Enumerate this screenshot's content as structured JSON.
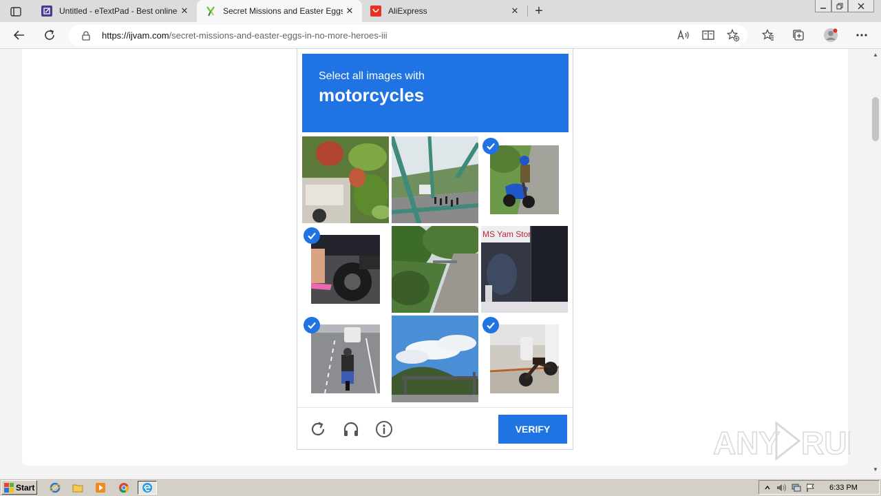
{
  "browser": {
    "tabs": [
      {
        "title": "Untitled - eTextPad - Best online T",
        "favicon": "etextpad-icon",
        "active": false
      },
      {
        "title": "Secret Missions and Easter Eggs in",
        "favicon": "ijvam-icon",
        "active": true
      },
      {
        "title": "AliExpress",
        "favicon": "aliexpress-icon",
        "active": false
      }
    ],
    "new_tab_label": "+",
    "url_host": "https://ijvam.com",
    "url_path": "/secret-missions-and-easter-eggs-in-no-more-heroes-iii",
    "toolbar_icons": [
      "read-aloud-icon",
      "immersive-reader-icon",
      "add-favorite-icon",
      "favorites-icon",
      "collections-icon",
      "profile-icon",
      "more-icon"
    ]
  },
  "captcha": {
    "instruction": "Select all images with",
    "target": "motorcycles",
    "tiles": [
      {
        "subject": "car-behind-leaves",
        "selected": false
      },
      {
        "subject": "bridge-crowd",
        "selected": false
      },
      {
        "subject": "motorcycle-rider-blue",
        "selected": true
      },
      {
        "subject": "motorcycle-wheel-feet",
        "selected": true
      },
      {
        "subject": "forest-road",
        "selected": false
      },
      {
        "subject": "store-front",
        "selected": false
      },
      {
        "subject": "motorcycle-highway",
        "selected": true
      },
      {
        "subject": "sky-gantry",
        "selected": false
      },
      {
        "subject": "parked-motorcycle",
        "selected": true
      }
    ],
    "verify_label": "VERIFY",
    "footer_icons": [
      "refresh-icon",
      "audio-icon",
      "info-icon"
    ],
    "accent": "#1f73e3"
  },
  "watermark": "ANY RUN",
  "taskbar": {
    "start_label": "Start",
    "quick_launch": [
      "ie-icon",
      "explorer-icon",
      "media-icon",
      "chrome-icon",
      "edge-icon"
    ],
    "clock": "6:33 PM"
  }
}
